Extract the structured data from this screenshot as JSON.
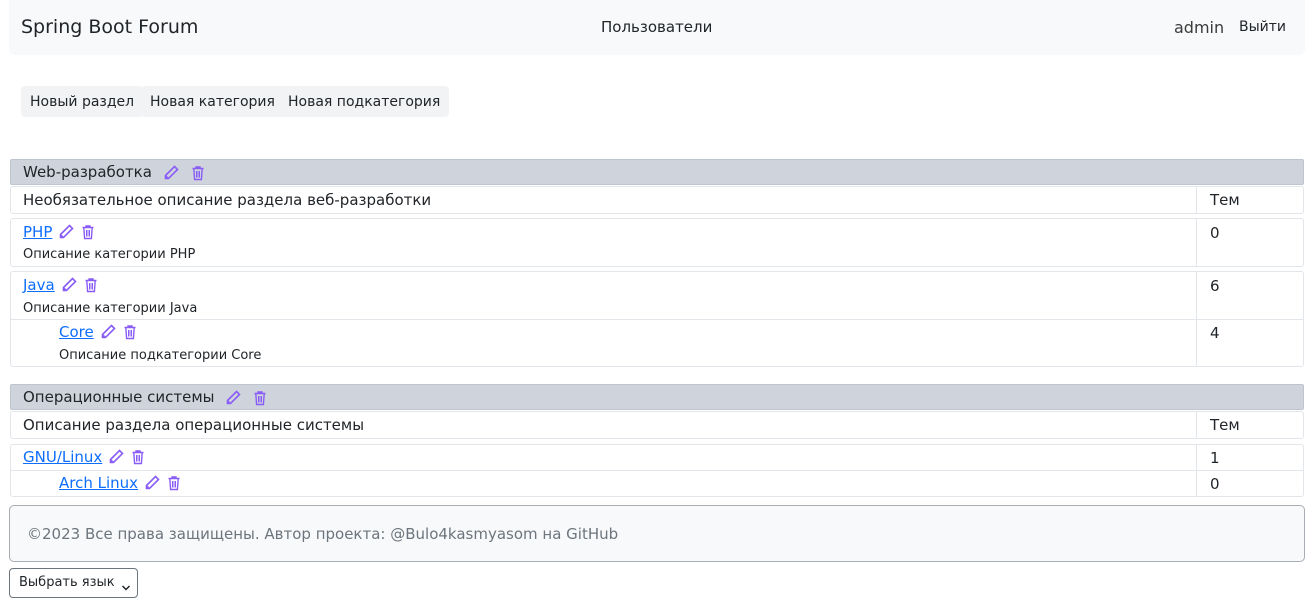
{
  "navbar": {
    "brand": "Spring Boot Forum",
    "users_link": "Пользователи",
    "username": "admin",
    "logout": "Выйти"
  },
  "actions": {
    "new_section": "Новый раздел",
    "new_category": "Новая категория",
    "new_subcategory": "Новая подкатегория"
  },
  "sections": [
    {
      "title": "Web-разработка",
      "description": "Необязательное описание раздела веб-разработки",
      "topics_header": "Тем",
      "categories": [
        {
          "name": "PHP",
          "description": "Описание категории PHP",
          "topics": "0"
        },
        {
          "name": "Java",
          "description": "Описание категории Java",
          "topics": "6",
          "subcategory": {
            "name": "Core",
            "description": "Описание подкатегории Core",
            "topics": "4"
          }
        }
      ]
    },
    {
      "title": "Операционные системы",
      "description": "Описание раздела операционные системы",
      "topics_header": "Тем",
      "categories": [
        {
          "name": "GNU/Linux",
          "topics": "1",
          "subcategory": {
            "name": "Arch Linux",
            "topics": "0"
          }
        }
      ]
    }
  ],
  "footer": {
    "text": "©2023 Все права защищены. Автор проекта: @Bulo4kasmyasom на GitHub"
  },
  "language_select": {
    "selected": "Выбрать язык"
  },
  "icons": {
    "edit": "pencil-icon",
    "delete": "trash-icon",
    "icon_color": "#8a5cf6"
  }
}
